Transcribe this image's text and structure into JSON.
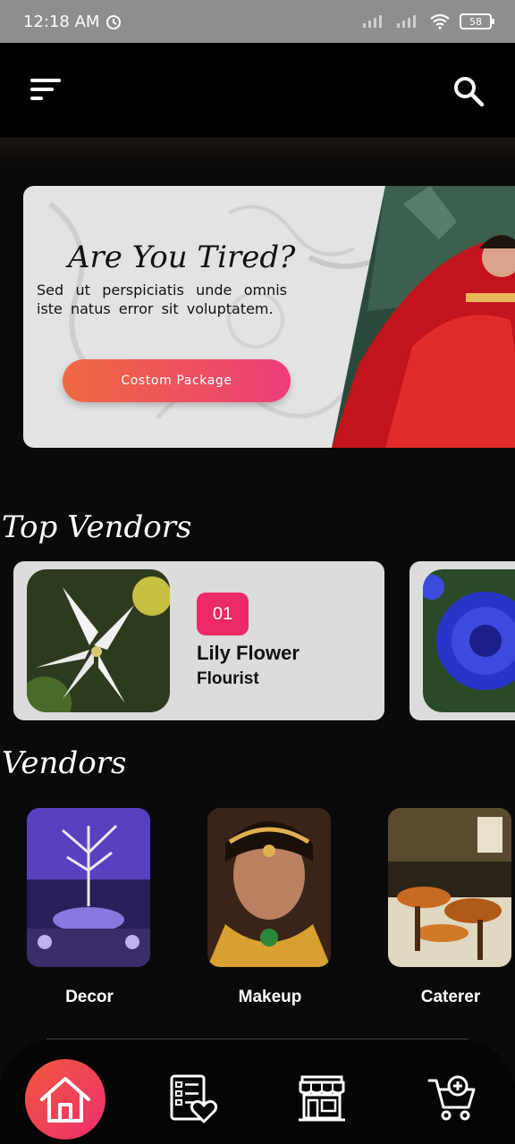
{
  "status_bar": {
    "time": "12:18 AM",
    "battery": "58"
  },
  "banner": {
    "title": "Are You Tired?",
    "text": "Sed ut perspiciatis unde omnis iste natus error sit voluptatem.",
    "button_label": "Costom Package"
  },
  "top_vendors": {
    "title": "Top Vendors",
    "items": [
      {
        "rank": "01",
        "name": "Lily Flower",
        "category": "Flourist"
      }
    ]
  },
  "vendors": {
    "title": "Vendors",
    "items": [
      {
        "label": "Decor"
      },
      {
        "label": "Makeup"
      },
      {
        "label": "Caterer"
      }
    ]
  },
  "colors": {
    "accent": "#EC2A66",
    "cta_start": "#EF6A3F",
    "cta_end": "#EC3D79"
  }
}
